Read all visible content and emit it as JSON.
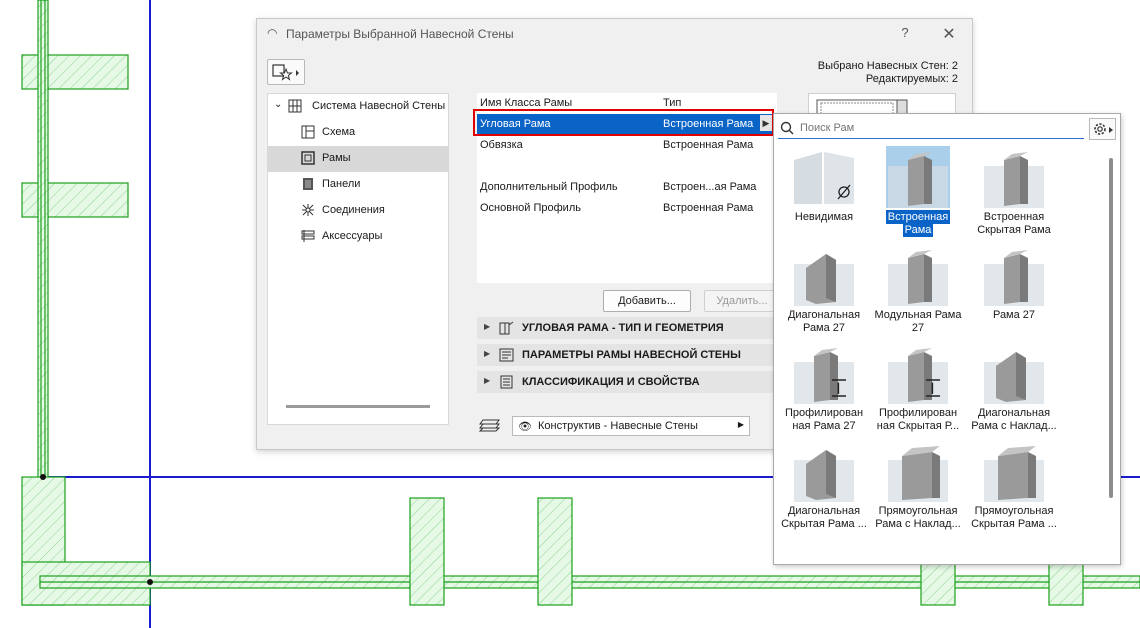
{
  "dialog": {
    "title": "Параметры Выбранной Навесной Стены",
    "help": "?",
    "close": "✕",
    "selected_info_1": "Выбрано Навесных Стен: 2",
    "selected_info_2": "Редактируемых: 2"
  },
  "tree": {
    "root": "Система Навесной Стены",
    "items": [
      {
        "label": "Схема",
        "icon": "scheme-icon"
      },
      {
        "label": "Рамы",
        "icon": "frames-icon",
        "selected": true
      },
      {
        "label": "Панели",
        "icon": "panels-icon"
      },
      {
        "label": "Соединения",
        "icon": "junctions-icon"
      },
      {
        "label": "Аксессуары",
        "icon": "accessories-icon"
      }
    ]
  },
  "params": {
    "header": {
      "col1": "Имя Класса Рамы",
      "col2": "Тип"
    },
    "rows": [
      {
        "name": "Угловая Рама",
        "type": "Встроенная Рама",
        "highlighted": true
      },
      {
        "name": "Обвязка",
        "type": "Встроенная Рама"
      },
      {
        "name": "Дополнительный Профиль",
        "type": "Встроен...ая Рама"
      },
      {
        "name": "Основной Профиль",
        "type": "Встроенная Рама"
      }
    ],
    "add_button": "Добавить...",
    "delete_button": "Удалить..."
  },
  "sections": [
    {
      "label": "УГЛОВАЯ РАМА - ТИП И ГЕОМЕТРИЯ"
    },
    {
      "label": "ПАРАМЕТРЫ РАМЫ НАВЕСНОЙ СТЕНЫ"
    },
    {
      "label": "КЛАССИФИКАЦИЯ И СВОЙСТВА"
    }
  ],
  "layer": {
    "label": "Конструктив - Навесные Стены"
  },
  "popup": {
    "search_placeholder": "Поиск Рам",
    "items": [
      {
        "l1": "Невидимая",
        "l2": "",
        "kind": "invisible"
      },
      {
        "l1": "Встроенная",
        "l2": "Рама",
        "kind": "frame",
        "selected": true
      },
      {
        "l1": "Встроенная",
        "l2": "Скрытая Рама",
        "kind": "frame"
      },
      {
        "l1": "Диагональная",
        "l2": "Рама 27",
        "kind": "diag"
      },
      {
        "l1": "Модульная Рама",
        "l2": "27",
        "kind": "frame"
      },
      {
        "l1": "Рама 27",
        "l2": "",
        "kind": "frame"
      },
      {
        "l1": "Профилирован",
        "l2": "ная Рама 27",
        "kind": "profile"
      },
      {
        "l1": "Профилирован",
        "l2": "ная Скрытая Р...",
        "kind": "profile"
      },
      {
        "l1": "Диагональная",
        "l2": "Рама с Наклад...",
        "kind": "diag"
      },
      {
        "l1": "Диагональная",
        "l2": "Скрытая Рама ...",
        "kind": "diag"
      },
      {
        "l1": "Прямоугольная",
        "l2": "Рама с Наклад...",
        "kind": "rect"
      },
      {
        "l1": "Прямоугольная",
        "l2": "Скрытая Рама ...",
        "kind": "rect"
      },
      {
        "l1": "",
        "l2": "",
        "kind": "wood"
      },
      {
        "l1": "",
        "l2": "",
        "kind": "wood"
      }
    ]
  },
  "colors": {
    "accent": "#0a64c8",
    "highlight_border": "#e00000",
    "plan_blue": "#1a1ad0",
    "plan_green": "#1aa01a"
  }
}
